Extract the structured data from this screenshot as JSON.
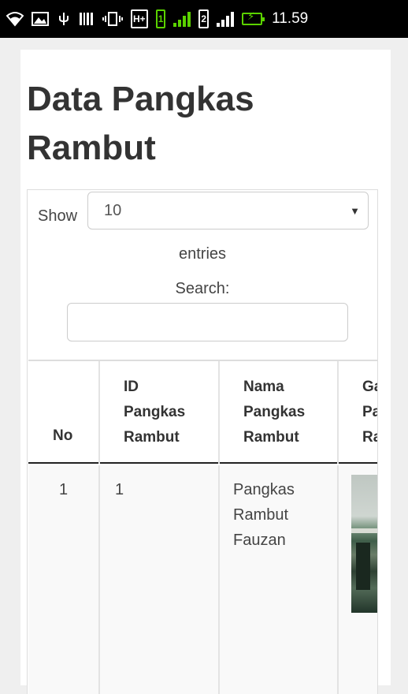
{
  "status_bar": {
    "time": "11.59",
    "icons": [
      "wifi-icon",
      "image-icon",
      "usb-icon",
      "barcode-icon",
      "vibrate-icon",
      "hplus-icon",
      "signal-sim1-icon",
      "signal-sim2-icon",
      "battery-charging-icon"
    ],
    "network_type": "H+",
    "sim1_label": "1",
    "sim2_label": "2",
    "accent_color": "#5bd200"
  },
  "page": {
    "title": "Data Pangkas Rambut"
  },
  "table_controls": {
    "show_label": "Show",
    "page_length_value": "10",
    "entries_label": "entries",
    "search_label": "Search:",
    "search_value": ""
  },
  "table": {
    "columns": [
      "No",
      "ID\nPangkas\nRambut",
      "Nama\nPangkas\nRambut",
      "Gambar\nPangkas\nRambut"
    ],
    "rows": [
      {
        "no": "1",
        "id": "1",
        "nama": "Pangkas\nRambut\nFauzan",
        "gambar": "photo"
      }
    ]
  }
}
